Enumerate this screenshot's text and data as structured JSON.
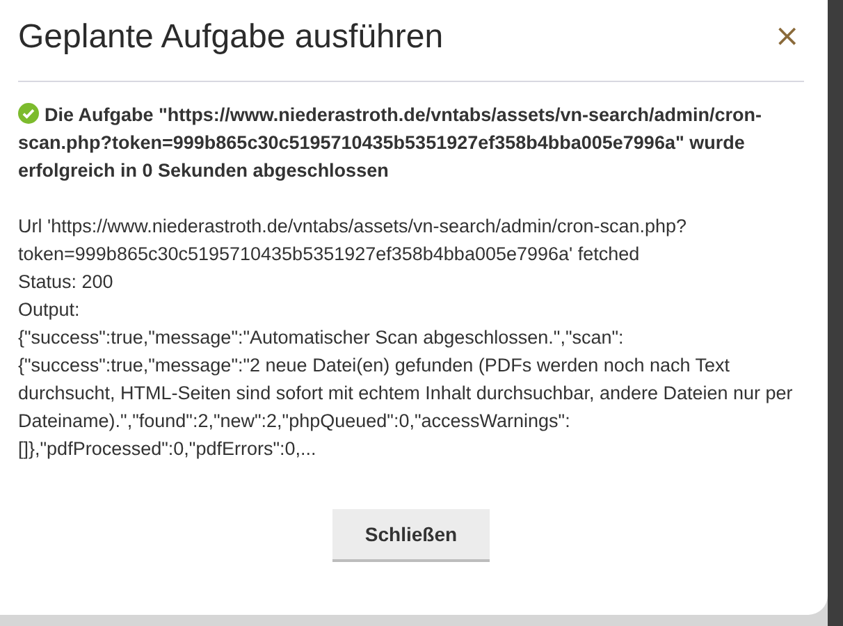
{
  "dialog": {
    "title": "Geplante Aufgabe ausführen",
    "close": "×",
    "result": {
      "kind": "success",
      "message": "Die Aufgabe \"https://www.niederastroth.de/vntabs/assets/vn-search/admin/cron-scan.php?token=999b865c30c5195710435b5351927ef358b4bba005e7996a\" wurde erfolgreich in 0 Sekunden abgeschlossen"
    },
    "details": [
      "Url 'https://www.niederastroth.de/vntabs/assets/vn-search/admin/cron-scan.php?token=999b865c30c5195710435b5351927ef358b4bba005e7996a' fetched",
      "Status: 200",
      "Output:",
      "{\"success\":true,\"message\":\"Automatischer Scan abgeschlossen.\",\"scan\":{\"success\":true,\"message\":\"2 neue Datei(en) gefunden (PDFs werden noch nach Text durchsucht, HTML-Seiten sind sofort mit echtem Inhalt durchsuchbar, andere Dateien nur per Dateiname).\",\"found\":2,\"new\":2,\"phpQueued\":0,\"accessWarnings\":[]},\"pdfProcessed\":0,\"pdfErrors\":0,..."
    ],
    "button": "Schließen"
  }
}
